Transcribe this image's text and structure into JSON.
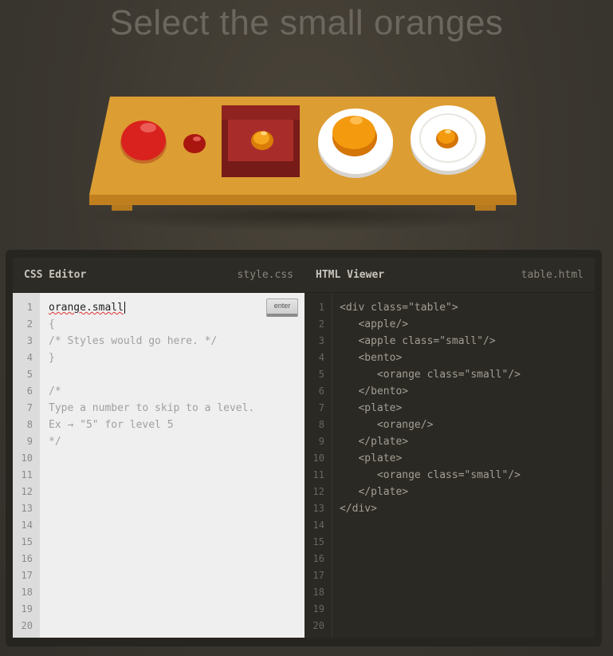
{
  "header": {
    "title": "Select the small oranges"
  },
  "css_editor": {
    "title": "CSS Editor",
    "filename": "style.css",
    "input_value": "orange.small",
    "enter_label": "enter",
    "lines": [
      "{",
      "/* Styles would go here. */",
      "}",
      "",
      "/*",
      "Type a number to skip to a level.",
      "Ex → \"5\" for level 5",
      "*/"
    ],
    "line_numbers": [
      "1",
      "2",
      "3",
      "4",
      "5",
      "6",
      "7",
      "8",
      "9",
      "10",
      "11",
      "12",
      "13",
      "14",
      "15",
      "16",
      "17",
      "18",
      "19",
      "20"
    ]
  },
  "html_viewer": {
    "title": "HTML Viewer",
    "filename": "table.html",
    "lines": [
      "<div class=\"table\">",
      "   <apple/>",
      "   <apple class=\"small\"/>",
      "   <bento>",
      "      <orange class=\"small\"/>",
      "   </bento>",
      "   <plate>",
      "      <orange/>",
      "   </plate>",
      "   <plate>",
      "      <orange class=\"small\"/>",
      "   </plate>",
      "</div>"
    ],
    "line_numbers": [
      "1",
      "2",
      "3",
      "4",
      "5",
      "6",
      "7",
      "8",
      "9",
      "10",
      "11",
      "12",
      "13",
      "14",
      "15",
      "16",
      "17",
      "18",
      "19",
      "20"
    ]
  },
  "colors": {
    "table": "#d89a30",
    "apple": "#d9221e",
    "orange": "#f39a0e",
    "bento": "#8e2320",
    "plate": "#ffffff"
  }
}
